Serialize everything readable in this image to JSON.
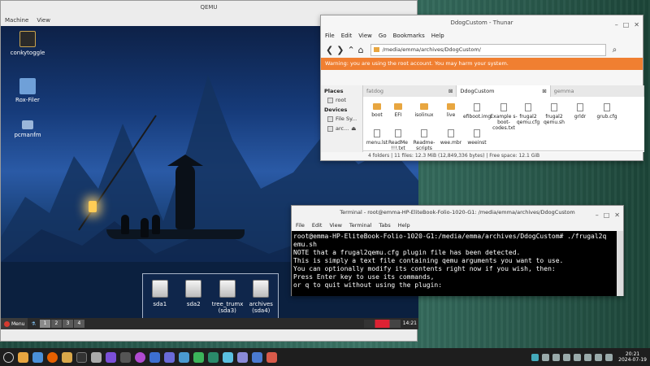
{
  "qemu": {
    "title": "QEMU",
    "menu": [
      "Machine",
      "View"
    ],
    "desktop_icons": [
      {
        "label": "conkytoggle",
        "icon": "conky-monitor-icon"
      },
      {
        "label": "Rox-Filer",
        "icon": "rox-home-icon"
      },
      {
        "label": "pcmanfm",
        "icon": "folder-icon"
      }
    ],
    "drives": [
      {
        "label": "sda1",
        "sub": ""
      },
      {
        "label": "sda2",
        "sub": ""
      },
      {
        "label": "tree_trumx",
        "sub": "(sda3)"
      },
      {
        "label": "archives",
        "sub": "(sda4)"
      }
    ],
    "panel": {
      "menu_label": "Menu",
      "workspaces": [
        "1",
        "2",
        "3",
        "4"
      ],
      "clock": "14:21"
    }
  },
  "thunar": {
    "title": "DdogCustom - Thunar",
    "menu": [
      "File",
      "Edit",
      "View",
      "Go",
      "Bookmarks",
      "Help"
    ],
    "path": "/media/emma/archives/DdogCustom/",
    "warning": "Warning: you are using the root account. You may harm your system.",
    "places_header": "Places",
    "places": [
      {
        "label": "root"
      }
    ],
    "devices_header": "Devices",
    "devices": [
      {
        "label": "File Sy..."
      },
      {
        "label": "arc..."
      }
    ],
    "tabs": [
      {
        "label": "fatdog",
        "active": false
      },
      {
        "label": "DdogCustom",
        "active": true
      },
      {
        "label": "gemma",
        "active": false
      }
    ],
    "tab_close": "⊠",
    "files": [
      {
        "name": "boot",
        "kind": "folder"
      },
      {
        "name": "EFI",
        "kind": "folder"
      },
      {
        "name": "isolinux",
        "kind": "folder"
      },
      {
        "name": "live",
        "kind": "folder"
      },
      {
        "name": "efiboot.img",
        "kind": "doc"
      },
      {
        "name": "Example s-boot-codes.txt",
        "kind": "doc"
      },
      {
        "name": "frugal2 qemu.cfg",
        "kind": "doc"
      },
      {
        "name": "frugal2 qemu.sh",
        "kind": "doc"
      },
      {
        "name": "grldr",
        "kind": "doc"
      },
      {
        "name": "grub.cfg",
        "kind": "doc"
      },
      {
        "name": "menu.lst",
        "kind": "doc"
      },
      {
        "name": "ReadMe !!!.txt",
        "kind": "doc"
      },
      {
        "name": "Readme-scripts",
        "kind": "doc"
      },
      {
        "name": "wee.mbr",
        "kind": "doc"
      },
      {
        "name": "weeinst",
        "kind": "doc"
      }
    ],
    "status": "4 folders  |  11 files: 12.3 MiB (12,849,336 bytes)  |  Free space: 12.1 GiB"
  },
  "terminal": {
    "title": "Terminal - root@emma-HP-EliteBook-Folio-1020-G1: /media/emma/archives/DdogCustom",
    "menu": [
      "File",
      "Edit",
      "View",
      "Terminal",
      "Tabs",
      "Help"
    ],
    "lines": [
      "root@emma-HP-EliteBook-Folio-1020-G1:/media/emma/archives/DdogCustom# ./frugal2q",
      "emu.sh",
      "",
      "NOTE that a frugal2qemu.cfg plugin file has been detected.",
      "This is simply a text file containing qemu arguments you want to use.",
      "You can optionally modify its contents right now if you wish, then:",
      "Press Enter key to use its commands,",
      "or q to quit without using the plugin:"
    ]
  },
  "taskbar": {
    "apps": [
      "menu-icon",
      "files-icon",
      "browser-icon",
      "firefox-icon",
      "folder-icon",
      "terminal-icon",
      "settings-icon",
      "shield-icon",
      "gamepad-icon",
      "vpn-icon",
      "chat-icon",
      "teams-icon",
      "chart-icon",
      "image-icon",
      "network-icon",
      "calc-icon",
      "editor-icon",
      "photo-icon",
      "note-icon"
    ],
    "clock_time": "20:21",
    "clock_date": "2024-07-19"
  }
}
